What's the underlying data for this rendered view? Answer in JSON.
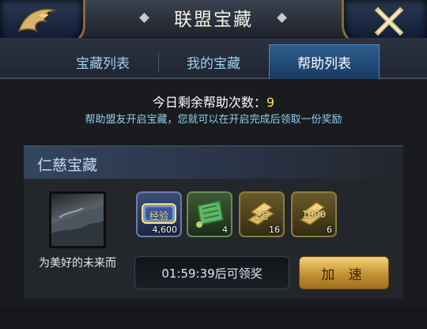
{
  "header": {
    "title": "联盟宝藏",
    "left_icon": "dragon-emblem-icon",
    "right_icon": "close-icon"
  },
  "tabs": [
    {
      "label": "宝藏列表",
      "active": false
    },
    {
      "label": "我的宝藏",
      "active": false
    },
    {
      "label": "帮助列表",
      "active": true
    }
  ],
  "info": {
    "remaining_label": "今日剩余帮助次数：",
    "remaining_count": "9",
    "description": "帮助盟友开启宝藏，您就可以在开启完成后领取一份奖励"
  },
  "treasure": {
    "title": "仁慈宝藏",
    "owner_name": "为美好的未来而",
    "rewards": [
      {
        "icon": "experience-icon",
        "label": "经验",
        "count": "4,600"
      },
      {
        "icon": "green-scroll-icon",
        "count": "4"
      },
      {
        "icon": "gold-bars-icon",
        "label": "1万",
        "count": "16"
      },
      {
        "icon": "gold-bars-icon",
        "label": "1000",
        "count": "6"
      }
    ],
    "timer_text": "01:59:39后可领奖",
    "speed_button": "加 速"
  },
  "colors": {
    "accent_blue": "#8fd3f0",
    "count_yellow": "#ffe44d",
    "gold": "#c49232"
  }
}
